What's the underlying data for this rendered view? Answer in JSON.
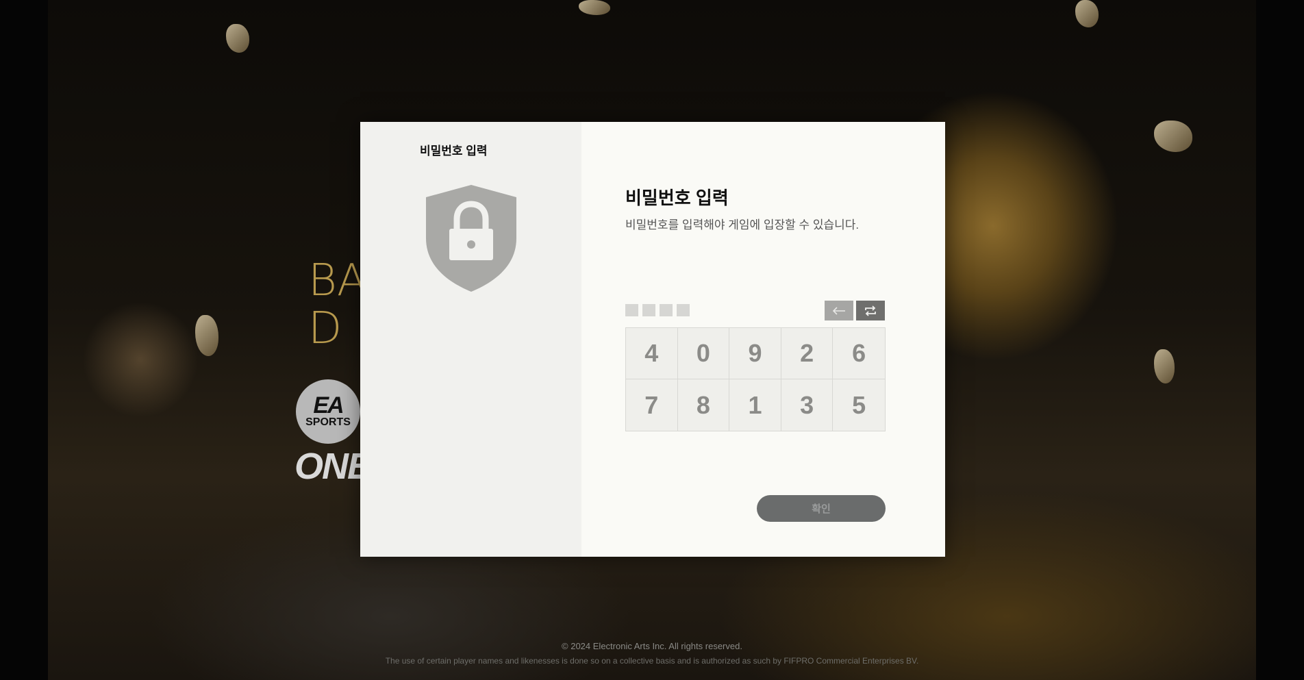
{
  "background": {
    "logo_text": "BA\nD",
    "brand_badge_top": "EA",
    "brand_badge_bottom": "SPORTS",
    "brand_word": "ONE"
  },
  "dialog": {
    "sidebar_title": "비밀번호 입력",
    "heading": "비밀번호 입력",
    "description": "비밀번호를 입력해야 게임에 입장할 수 있습니다.",
    "pin_slots": 4,
    "keypad": [
      "4",
      "0",
      "9",
      "2",
      "6",
      "7",
      "8",
      "1",
      "3",
      "5"
    ],
    "confirm_label": "확인"
  },
  "footer": {
    "copyright": "© 2024 Electronic Arts Inc. All rights reserved.",
    "notice": "The use of certain player names and likenesses is done so on a collective basis and is authorized as such by FIFPRO Commercial Enterprises BV."
  }
}
